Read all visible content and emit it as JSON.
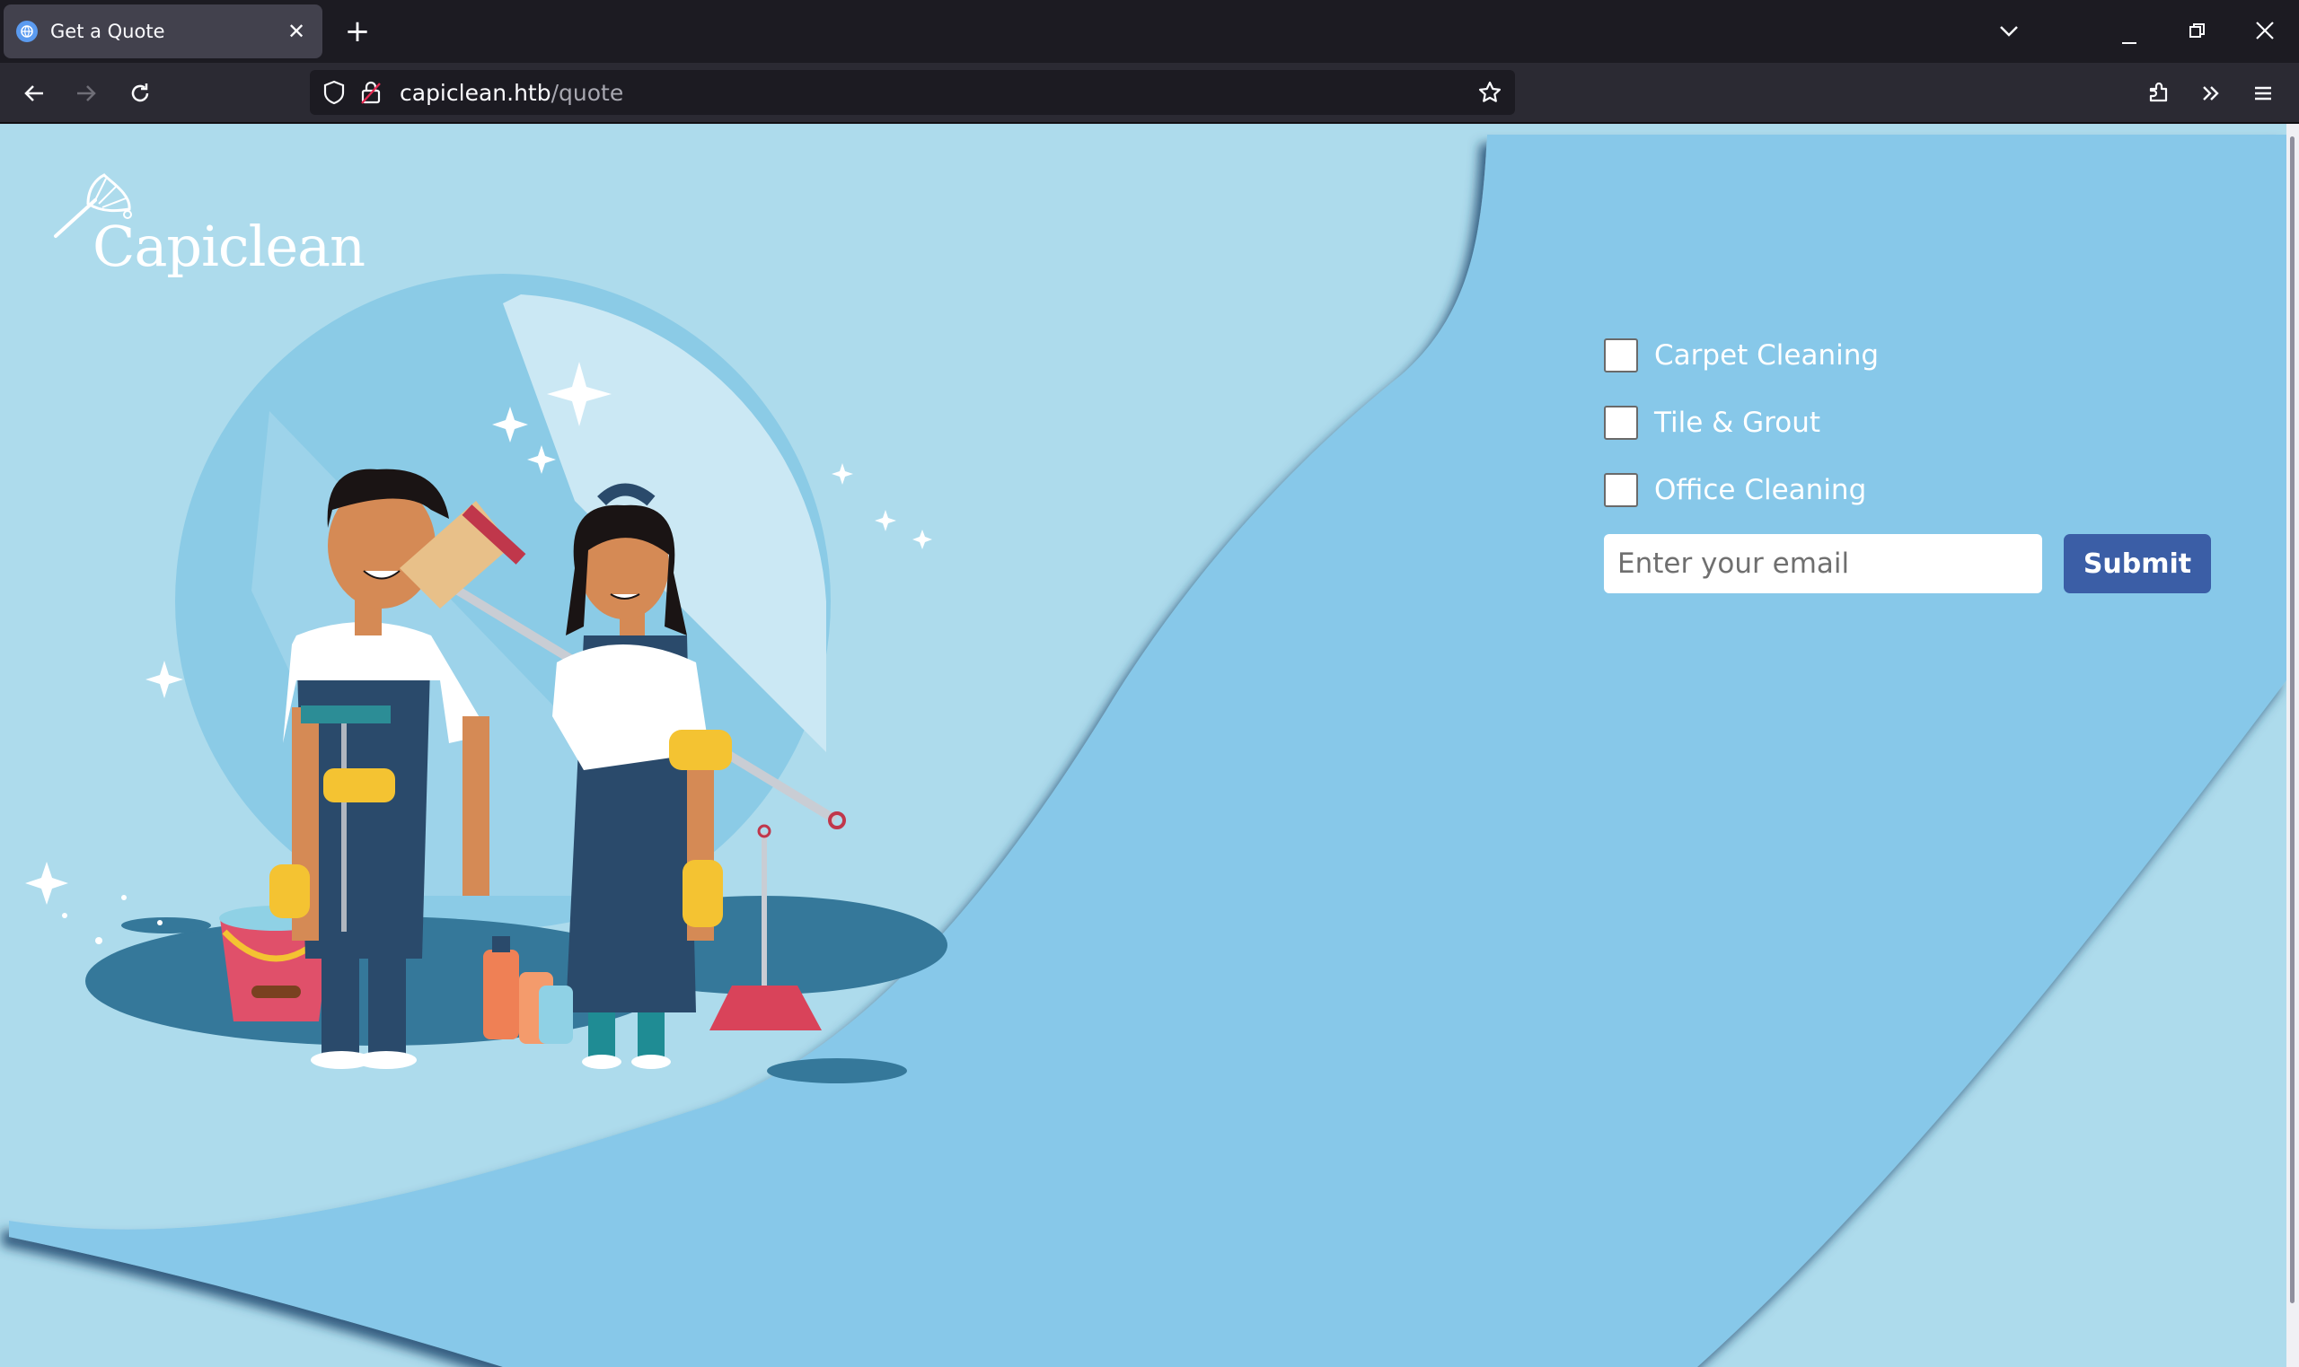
{
  "browser": {
    "tab_title": "Get a Quote",
    "url_host": "capiclean.htb",
    "url_path": "/quote"
  },
  "page": {
    "logo_text": "Capiclean",
    "services": [
      {
        "label": "Carpet Cleaning",
        "checked": false
      },
      {
        "label": "Tile & Grout",
        "checked": false
      },
      {
        "label": "Office Cleaning",
        "checked": false
      }
    ],
    "email_placeholder": "Enter your email",
    "submit_label": "Submit"
  },
  "colors": {
    "page_bg": "#addbec",
    "wave": "#87c8e9",
    "submit_bg": "#3b5ea6"
  }
}
